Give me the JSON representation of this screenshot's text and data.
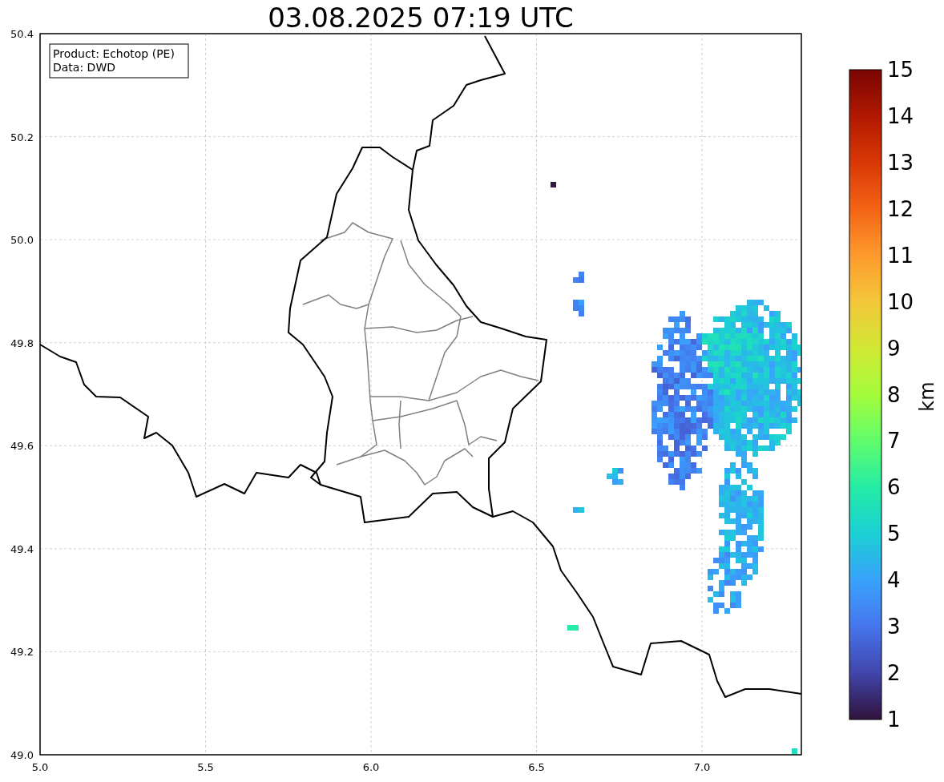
{
  "title": "03.08.2025 07:19 UTC",
  "info_box": [
    "Product: Echotop (PE)",
    "Data: DWD"
  ],
  "x_axis": {
    "ticks": [
      "5.0",
      "5.5",
      "6.0",
      "6.5",
      "7.0"
    ]
  },
  "y_axis": {
    "ticks": [
      "50.4",
      "50.2",
      "50.0",
      "49.8",
      "49.6",
      "49.4",
      "49.2",
      "49.0"
    ]
  },
  "colorbar": {
    "label": "km",
    "ticks": [
      "15",
      "14",
      "13",
      "12",
      "11",
      "10",
      "9",
      "8",
      "7",
      "6",
      "5",
      "4",
      "3",
      "2",
      "1"
    ]
  }
}
